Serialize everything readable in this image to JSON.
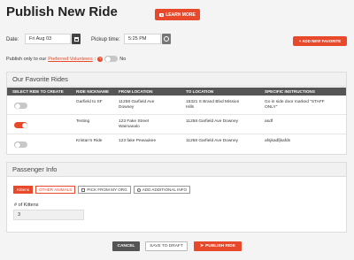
{
  "page": {
    "title": "Publish New Ride"
  },
  "learn_more": {
    "label": "LEARN MORE",
    "icon": "video-icon"
  },
  "date": {
    "label": "Date:",
    "value": "Fri Aug 03",
    "icon": "calendar-icon"
  },
  "pickup": {
    "label": "Pickup time:",
    "value": "5:25 PM",
    "icon": "clock-icon"
  },
  "add_favorite": {
    "label": "+ ADD NEW FAVORITE"
  },
  "preferred": {
    "prefix": "Publish only to our",
    "link": "Preferred Volunteers",
    "suffix": ":",
    "help": "?",
    "toggle_label": "No"
  },
  "favorites": {
    "title": "Our Favorite Rides",
    "columns": [
      "SELECT RIDE TO CREATE",
      "RIDE NICKNAME",
      "FROM LOCATION",
      "TO LOCATION",
      "SPECIFIC INSTRUCTIONS"
    ],
    "rows": [
      {
        "selected": false,
        "nickname": "Garfield to SF",
        "from_l1": "11258 Garfield Ave",
        "from_l2": "Downey",
        "to_l1": "15321 S Brand Blvd Mission",
        "to_l2": "Hills",
        "instr_l1": "Go in side door marked \"STAFF",
        "instr_l2": "ONLY\""
      },
      {
        "selected": true,
        "nickname": "Testing",
        "from_l1": "123 Fake Street",
        "from_l2": "Waimanalo",
        "to_l1": "11258 Garfield Ave Downey",
        "to_l2": "",
        "instr_l1": "asdf",
        "instr_l2": ""
      },
      {
        "selected": false,
        "nickname": "Kristan's Ride",
        "from_l1": "123 fake Pewaukee",
        "from_l2": "",
        "to_l1": "11258 Garfield Ave Downey",
        "to_l2": "",
        "instr_l1": "afsjkadfjkafds",
        "instr_l2": ""
      }
    ]
  },
  "passenger": {
    "title": "Passenger Info",
    "tabs": {
      "kittens": "Kittens",
      "other_animals": "OTHER ANIMALS",
      "pick_org": "PICK FROM MY ORG",
      "add_info": "ADD ADDITIONAL INFO"
    },
    "count_label": "# of Kittens",
    "count_value": "3"
  },
  "actions": {
    "cancel": "CANCEL",
    "draft": "SAVE TO DRAFT",
    "publish": "PUBLISH RIDE"
  },
  "colors": {
    "accent": "#e8492a",
    "header_dark": "#555555"
  }
}
